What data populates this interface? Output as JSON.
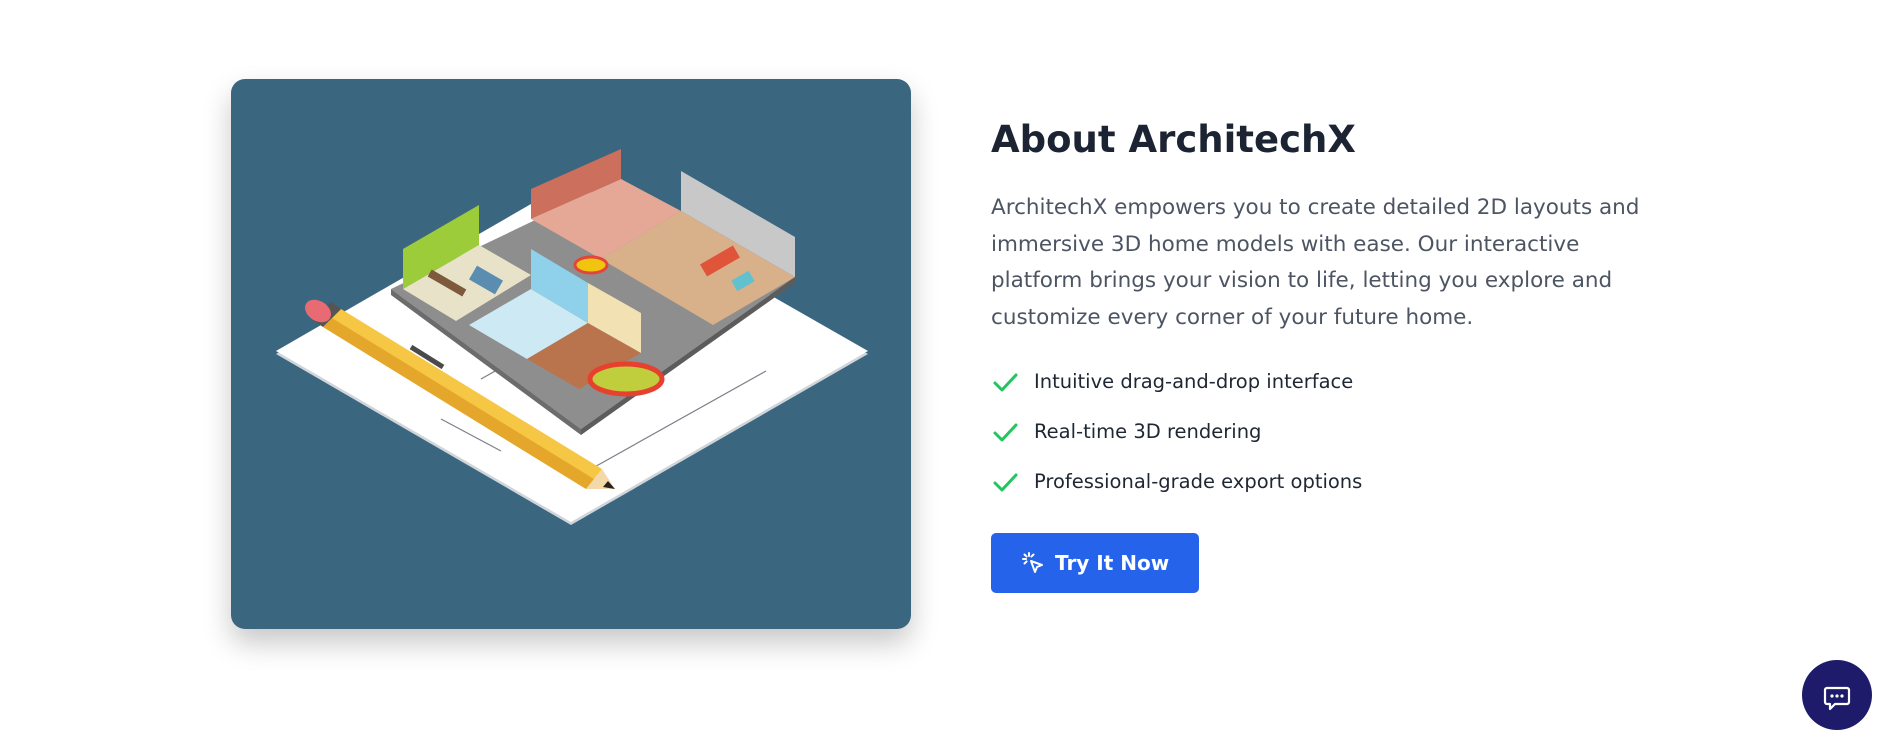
{
  "about": {
    "illustration": "isometric-house-floorplan-with-pencil",
    "title": "About ArchitechX",
    "description": "ArchitechX empowers you to create detailed 2D layouts and immersive 3D home models with ease. Our interactive platform brings your vision to life, letting you explore and customize every corner of your future home.",
    "features": [
      {
        "icon": "check-icon",
        "label": "Intuitive drag-and-drop interface"
      },
      {
        "icon": "check-icon",
        "label": "Real-time 3D rendering"
      },
      {
        "icon": "check-icon",
        "label": "Professional-grade export options"
      }
    ],
    "cta": {
      "icon": "cursor-click-icon",
      "label": "Try It Now"
    }
  },
  "chat": {
    "icon": "chat-icon"
  },
  "colors": {
    "card_bg": "#3b6680",
    "accent": "#2563eb",
    "check": "#22c55e",
    "chat_bg": "#1e1b6b"
  }
}
